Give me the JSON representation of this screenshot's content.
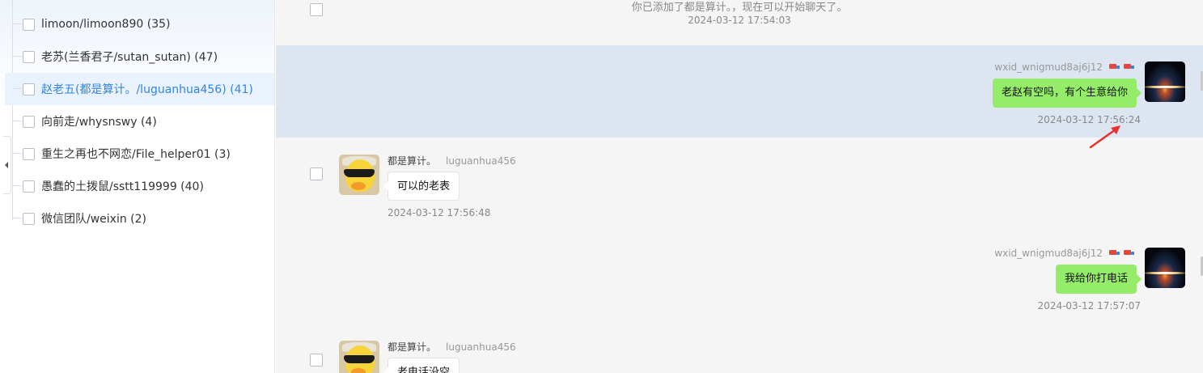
{
  "sidebar": {
    "contacts": [
      {
        "label": "limoon/limoon890 (35)",
        "active": false
      },
      {
        "label": "老苏(兰香君子/sutan_sutan) (47)",
        "active": false
      },
      {
        "label": "赵老五(都是算计。/luguanhua456) (41)",
        "active": true
      },
      {
        "label": "向前走/whysnswy (4)",
        "active": false
      },
      {
        "label": "重生之再也不网恋/File_helper01 (3)",
        "active": false
      },
      {
        "label": "愚蠢的土拨鼠/sstt119999 (40)",
        "active": false
      },
      {
        "label": "微信团队/weixin (2)",
        "active": false
      }
    ],
    "active_color": "#2f86e8"
  },
  "chat": {
    "system_message": {
      "text": "你已添加了都是算计。，现在可以开始聊天了。",
      "time": "2024-03-12 17:54:03"
    },
    "messages": [
      {
        "direction": "out",
        "sender_id": "wxid_wnigmud8aj6j12",
        "text": "老赵有空吗，有个生意给你",
        "time": "2024-03-12 17:56:24",
        "highlighted": true
      },
      {
        "direction": "in",
        "nickname": "都是算计。",
        "sender_id": "luguanhua456",
        "text": "可以的老表",
        "time": "2024-03-12 17:56:48"
      },
      {
        "direction": "out",
        "sender_id": "wxid_wnigmud8aj6j12",
        "text": "我给你打电话",
        "time": "2024-03-12 17:57:07"
      },
      {
        "direction": "in",
        "nickname": "都是算计。",
        "sender_id": "luguanhua456",
        "text": "老电话没空",
        "time": ""
      }
    ],
    "colors": {
      "own_bubble": "#95ec69",
      "highlight_row": "#dde5f0",
      "annotation_arrow": "#e8302f"
    },
    "icons": [
      "checkbox",
      "truck-icon",
      "space-avatar",
      "duck-avatar",
      "red-arrow-annotation"
    ]
  }
}
